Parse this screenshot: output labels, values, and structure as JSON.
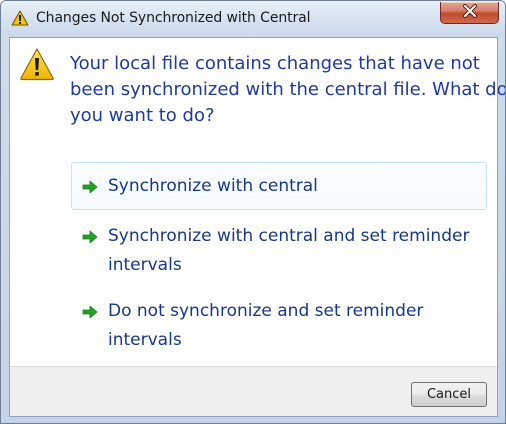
{
  "window": {
    "title": "Changes Not Synchronized with Central",
    "title_icon": "warning-icon",
    "close_icon": "close-icon"
  },
  "dialog": {
    "icon": "warning-icon",
    "main_instruction_lines": [
      "Your local file contains changes that have not",
      "been synchronized with the central file. What do",
      "you want to do?"
    ],
    "commands": [
      {
        "icon": "green-arrow-icon",
        "lines": [
          "Synchronize with central"
        ]
      },
      {
        "icon": "green-arrow-icon",
        "lines": [
          "Synchronize with central and set reminder",
          "intervals"
        ]
      },
      {
        "icon": "green-arrow-icon",
        "lines": [
          "Do not synchronize and set reminder",
          "intervals"
        ]
      }
    ]
  },
  "footer": {
    "cancel_label": "Cancel"
  },
  "colors": {
    "instruction_text": "#1e3aa0",
    "command_text": "#15388a",
    "arrow_green": "#22a328",
    "warning_yellow": "#f5c400",
    "close_red": "#c24a2f"
  }
}
